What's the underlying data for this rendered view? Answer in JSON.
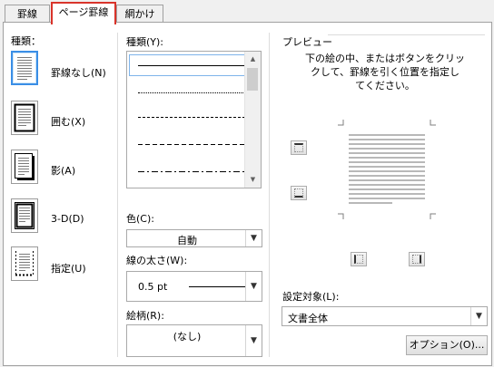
{
  "tabs": [
    {
      "label": "罫線"
    },
    {
      "label": "ページ罫線"
    },
    {
      "label": "網かけ"
    }
  ],
  "settings": {
    "title": "種類：",
    "items": [
      {
        "label": "罫線なし(N)",
        "selected": true
      },
      {
        "label": "囲む(X)",
        "selected": false
      },
      {
        "label": "影(A)",
        "selected": false
      },
      {
        "label": "3-D(D)",
        "selected": false
      },
      {
        "label": "指定(U)",
        "selected": false
      }
    ]
  },
  "style": {
    "label": "種類(Y):",
    "options": [
      "solid",
      "dotted",
      "dashed-small",
      "dashed-large",
      "dash-dot"
    ],
    "selected": "solid"
  },
  "color": {
    "label": "色(C):",
    "value": "自動"
  },
  "width": {
    "label": "線の太さ(W):",
    "value": "0.5 pt"
  },
  "art": {
    "label": "絵柄(R):",
    "value": "(なし)"
  },
  "preview": {
    "title": "プレビュー",
    "instructions_1": "下の絵の中、またはボタンをクリッ",
    "instructions_2": "クして、罫線を引く位置を指定し",
    "instructions_3": "てください。"
  },
  "apply_to": {
    "label": "設定対象(L):",
    "value": "文書全体"
  },
  "options_button": {
    "label": "オプション(O)..."
  }
}
